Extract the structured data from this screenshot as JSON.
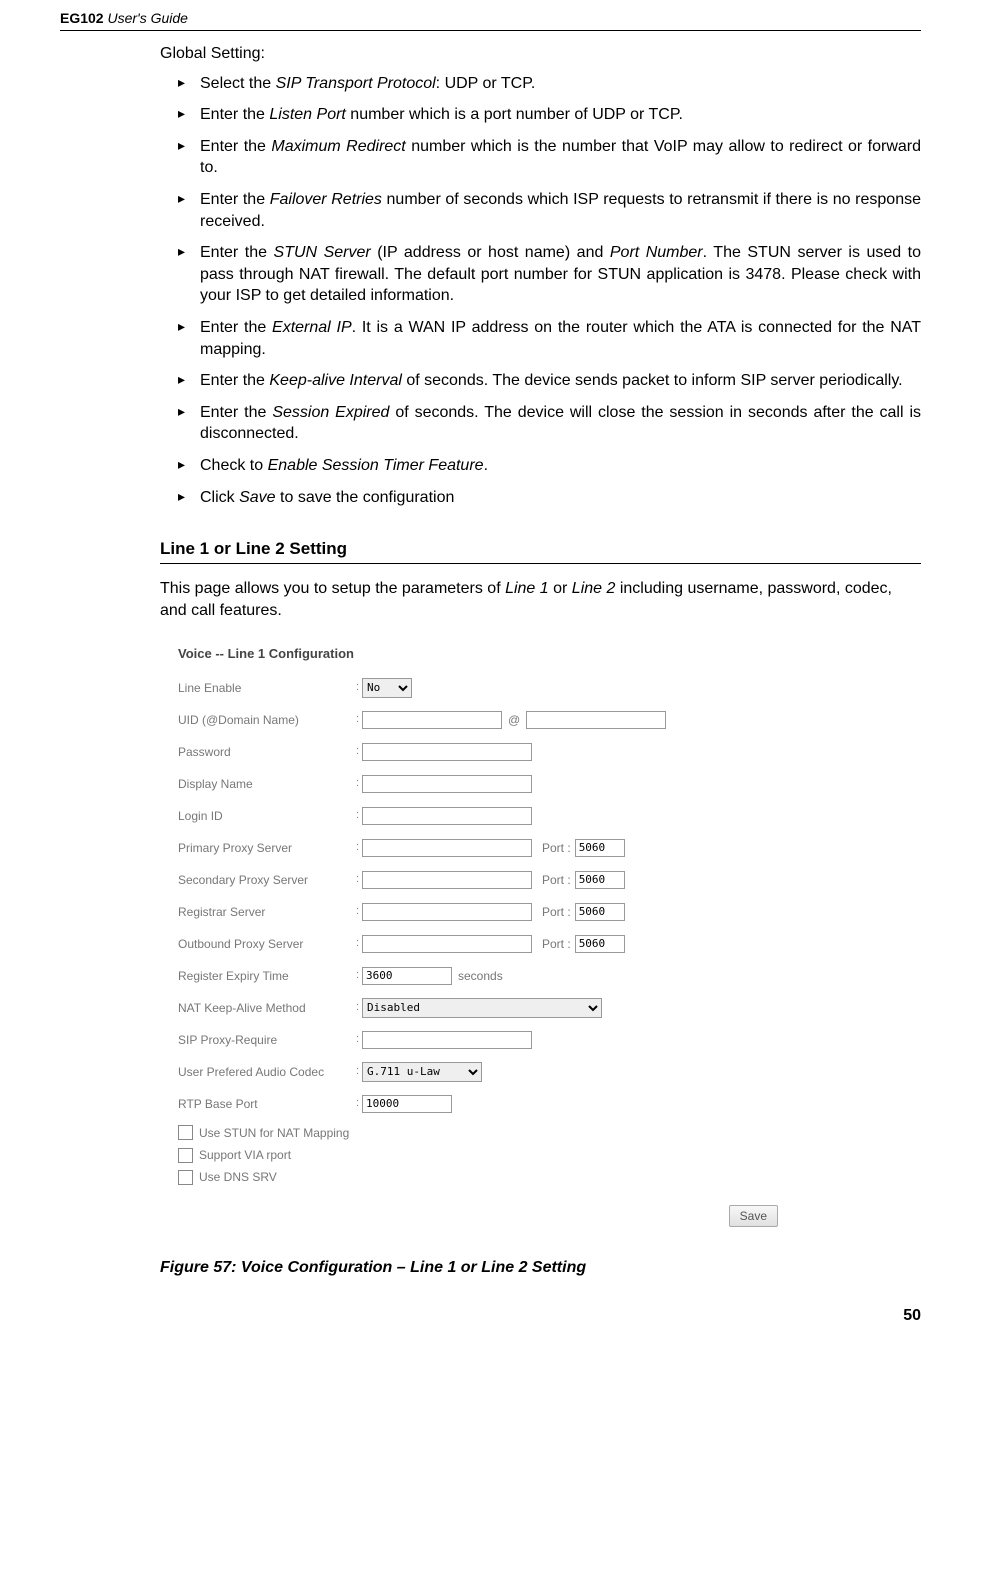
{
  "header": {
    "product": "EG102",
    "suffix": " User's Guide"
  },
  "global_setting_label": "Global Setting:",
  "bullets": [
    {
      "pre": "Select the ",
      "em": "SIP Transport Protocol",
      "post": ": UDP or TCP."
    },
    {
      "pre": "Enter the ",
      "em": "Listen Port",
      "post": " number which is a port number of UDP or TCP."
    },
    {
      "pre": "Enter the ",
      "em": "Maximum Redirect",
      "post": " number which is the number that VoIP may allow to redirect or forward to."
    },
    {
      "pre": "Enter the ",
      "em": "Failover Retries",
      "post": " number of seconds which ISP requests to retransmit if there is no response received."
    },
    {
      "pre": "Enter the ",
      "em": "STUN Server",
      "mid": " (IP address or host name) and ",
      "em2": "Port Number",
      "post": ". The STUN server is used to pass through NAT firewall. The default port number for STUN application is 3478. Please check with your ISP to get detailed information."
    },
    {
      "pre": "Enter the ",
      "em": "External IP",
      "post": ". It is a WAN IP address on the router which the ATA is connected for the NAT mapping."
    },
    {
      "pre": "Enter the ",
      "em": "Keep-alive Interval",
      "post": " of seconds. The device sends packet to inform SIP server periodically."
    },
    {
      "pre": "Enter the ",
      "em": "Session Expired",
      "post": " of seconds. The device will close the session in seconds after the call is disconnected."
    },
    {
      "pre": "Check to ",
      "em": "Enable Session Timer Feature",
      "post": "."
    },
    {
      "pre": "Click ",
      "em": "Save",
      "post": " to save the configuration"
    }
  ],
  "section": {
    "title": "Line 1 or Line 2 Setting",
    "desc_pre": "This page allows you to setup the parameters of ",
    "desc_em1": "Line 1",
    "desc_mid": " or ",
    "desc_em2": "Line 2",
    "desc_post": " including username, password, codec, and call features."
  },
  "ui": {
    "title": "Voice -- Line 1 Configuration",
    "line_enable_label": "Line Enable",
    "line_enable_value": "No",
    "uid_label": "UID (@Domain Name)",
    "at": "@",
    "password_label": "Password",
    "display_name_label": "Display Name",
    "login_id_label": "Login ID",
    "primary_proxy_label": "Primary Proxy Server",
    "secondary_proxy_label": "Secondary Proxy Server",
    "registrar_label": "Registrar Server",
    "outbound_proxy_label": "Outbound Proxy Server",
    "port_label": "Port :",
    "port_value": "5060",
    "register_expiry_label": "Register Expiry Time",
    "register_expiry_value": "3600",
    "seconds": "seconds",
    "nat_keepalive_label": "NAT Keep-Alive Method",
    "nat_keepalive_value": "Disabled",
    "sip_proxy_require_label": "SIP Proxy-Require",
    "codec_label": "User Prefered Audio Codec",
    "codec_value": "G.711 u-Law",
    "rtp_base_label": "RTP Base Port",
    "rtp_base_value": "10000",
    "check1": "Use STUN for NAT Mapping",
    "check2": "Support VIA rport",
    "check3": "Use DNS SRV",
    "save": "Save"
  },
  "figure_caption": "Figure 57: Voice Configuration – Line 1 or Line 2 Setting",
  "page_num": "50"
}
